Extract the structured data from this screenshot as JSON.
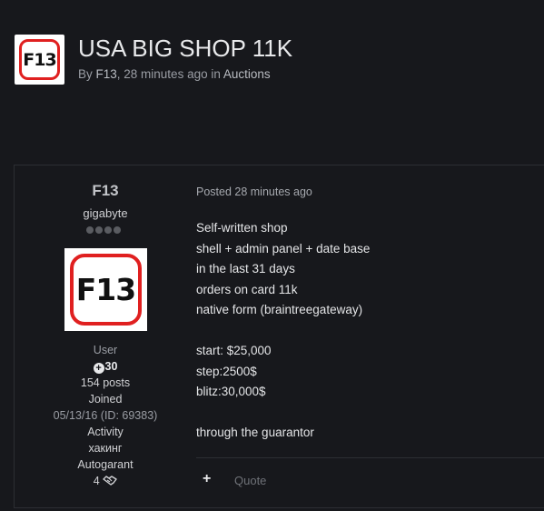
{
  "topic": {
    "logo_text": "F13",
    "title": "USA BIG SHOP 11K",
    "meta_prefix": "By ",
    "author": "F13",
    "meta_middle": ", 28 minutes ago in ",
    "forum": "Auctions"
  },
  "author_panel": {
    "name": "F13",
    "group": "gigabyte",
    "avatar_text": "F13",
    "role": "User",
    "reputation": "30",
    "posts": "154 posts",
    "joined_label": "Joined",
    "joined_value": "05/13/16 (ID: 69383)",
    "activity_label": "Activity",
    "activity_value": "хакинг",
    "autogarant_label": "Autogarant",
    "autogarant_value": "4"
  },
  "post": {
    "posted": "Posted 28 minutes ago",
    "lines": [
      "Self-written shop",
      "shell + admin panel + date base",
      "in the last 31 days",
      "orders on card 11k",
      "native form (braintreegateway)",
      "",
      "start: $25,000",
      "step:2500$",
      "blitz:30,000$",
      "",
      "through the guarantor"
    ],
    "plus_label": "+",
    "quote_label": "Quote"
  }
}
